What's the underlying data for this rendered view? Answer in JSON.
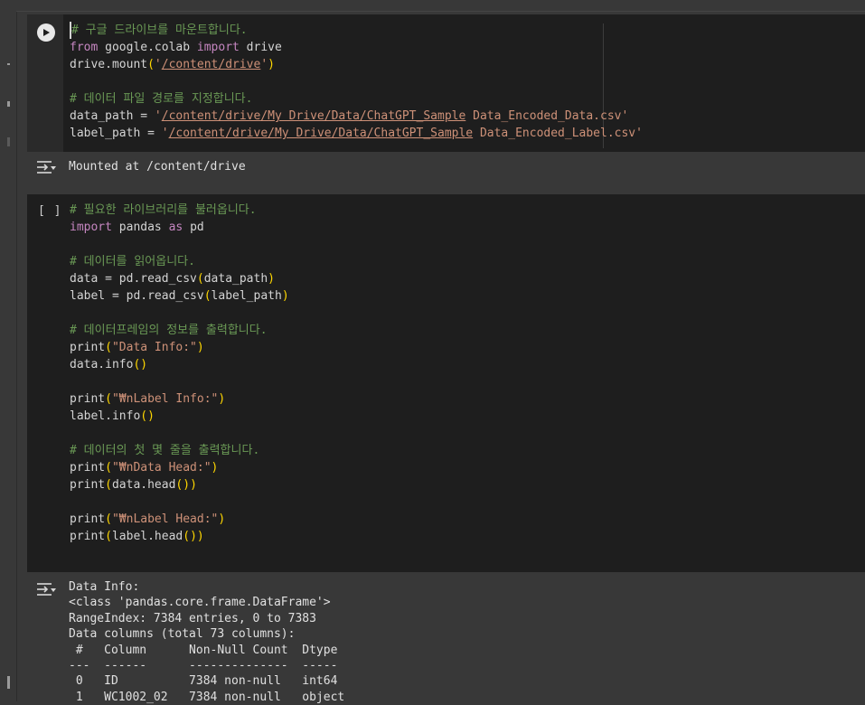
{
  "cell1": {
    "lines": [
      [
        {
          "t": "# 구글 드라이브를 마운트합니다.",
          "c": "cmt"
        }
      ],
      [
        {
          "t": "from",
          "c": "kw"
        },
        {
          "t": " google.colab ",
          "c": ""
        },
        {
          "t": "import",
          "c": "kw"
        },
        {
          "t": " drive",
          "c": ""
        }
      ],
      [
        {
          "t": "drive.mount",
          "c": ""
        },
        {
          "t": "(",
          "c": "paren"
        },
        {
          "t": "'",
          "c": "str"
        },
        {
          "t": "/content/drive",
          "c": "str u"
        },
        {
          "t": "'",
          "c": "str"
        },
        {
          "t": ")",
          "c": "paren"
        }
      ],
      [],
      [
        {
          "t": "# 데이터 파일 경로를 지정합니다.",
          "c": "cmt"
        }
      ],
      [
        {
          "t": "data_path = ",
          "c": ""
        },
        {
          "t": "'",
          "c": "str"
        },
        {
          "t": "/content/drive/My Drive/Data/ChatGPT_Sample",
          "c": "str u"
        },
        {
          "t": " Data_Encoded_Data.csv'",
          "c": "str"
        }
      ],
      [
        {
          "t": "label_path = ",
          "c": ""
        },
        {
          "t": "'",
          "c": "str"
        },
        {
          "t": "/content/drive/My Drive/Data/ChatGPT_Sample",
          "c": "str u"
        },
        {
          "t": " Data_Encoded_Label.csv'",
          "c": "str"
        }
      ]
    ]
  },
  "output1": {
    "text": "Mounted at /content/drive"
  },
  "cell2": {
    "bracket": "[ ]",
    "lines": [
      [
        {
          "t": "# 필요한 라이브러리를 불러옵니다.",
          "c": "cmt"
        }
      ],
      [
        {
          "t": "import",
          "c": "kw"
        },
        {
          "t": " pandas ",
          "c": ""
        },
        {
          "t": "as",
          "c": "kw"
        },
        {
          "t": " pd",
          "c": ""
        }
      ],
      [],
      [
        {
          "t": "# 데이터를 읽어옵니다.",
          "c": "cmt"
        }
      ],
      [
        {
          "t": "data = pd.read_csv",
          "c": ""
        },
        {
          "t": "(",
          "c": "paren"
        },
        {
          "t": "data_path",
          "c": ""
        },
        {
          "t": ")",
          "c": "paren"
        }
      ],
      [
        {
          "t": "label = pd.read_csv",
          "c": ""
        },
        {
          "t": "(",
          "c": "paren"
        },
        {
          "t": "label_path",
          "c": ""
        },
        {
          "t": ")",
          "c": "paren"
        }
      ],
      [],
      [
        {
          "t": "# 데이터프레임의 정보를 출력합니다.",
          "c": "cmt"
        }
      ],
      [
        {
          "t": "print",
          "c": ""
        },
        {
          "t": "(",
          "c": "paren"
        },
        {
          "t": "\"Data Info:\"",
          "c": "str"
        },
        {
          "t": ")",
          "c": "paren"
        }
      ],
      [
        {
          "t": "data.info",
          "c": ""
        },
        {
          "t": "()",
          "c": "paren"
        }
      ],
      [],
      [
        {
          "t": "print",
          "c": ""
        },
        {
          "t": "(",
          "c": "paren"
        },
        {
          "t": "\"₩nLabel Info:\"",
          "c": "str"
        },
        {
          "t": ")",
          "c": "paren"
        }
      ],
      [
        {
          "t": "label.info",
          "c": ""
        },
        {
          "t": "()",
          "c": "paren"
        }
      ],
      [],
      [
        {
          "t": "# 데이터의 첫 몇 줄을 출력합니다.",
          "c": "cmt"
        }
      ],
      [
        {
          "t": "print",
          "c": ""
        },
        {
          "t": "(",
          "c": "paren"
        },
        {
          "t": "\"₩nData Head:\"",
          "c": "str"
        },
        {
          "t": ")",
          "c": "paren"
        }
      ],
      [
        {
          "t": "print",
          "c": ""
        },
        {
          "t": "(",
          "c": "paren"
        },
        {
          "t": "data.head",
          "c": ""
        },
        {
          "t": "()",
          "c": "paren"
        },
        {
          "t": ")",
          "c": "paren"
        }
      ],
      [],
      [
        {
          "t": "print",
          "c": ""
        },
        {
          "t": "(",
          "c": "paren"
        },
        {
          "t": "\"₩nLabel Head:\"",
          "c": "str"
        },
        {
          "t": ")",
          "c": "paren"
        }
      ],
      [
        {
          "t": "print",
          "c": ""
        },
        {
          "t": "(",
          "c": "paren"
        },
        {
          "t": "label.head",
          "c": ""
        },
        {
          "t": "()",
          "c": "paren"
        },
        {
          "t": ")",
          "c": "paren"
        }
      ]
    ]
  },
  "output2": {
    "lines": [
      "Data Info:",
      "<class 'pandas.core.frame.DataFrame'>",
      "RangeIndex: 7384 entries, 0 to 7383",
      "Data columns (total 73 columns):",
      " #   Column      Non-Null Count  Dtype ",
      "---  ------      --------------  ----- ",
      " 0   ID          7384 non-null   int64 ",
      " 1   WC1002_02   7384 non-null   object"
    ]
  },
  "icons": {
    "run": "play-circle-icon",
    "output": "output-toggle-icon"
  }
}
